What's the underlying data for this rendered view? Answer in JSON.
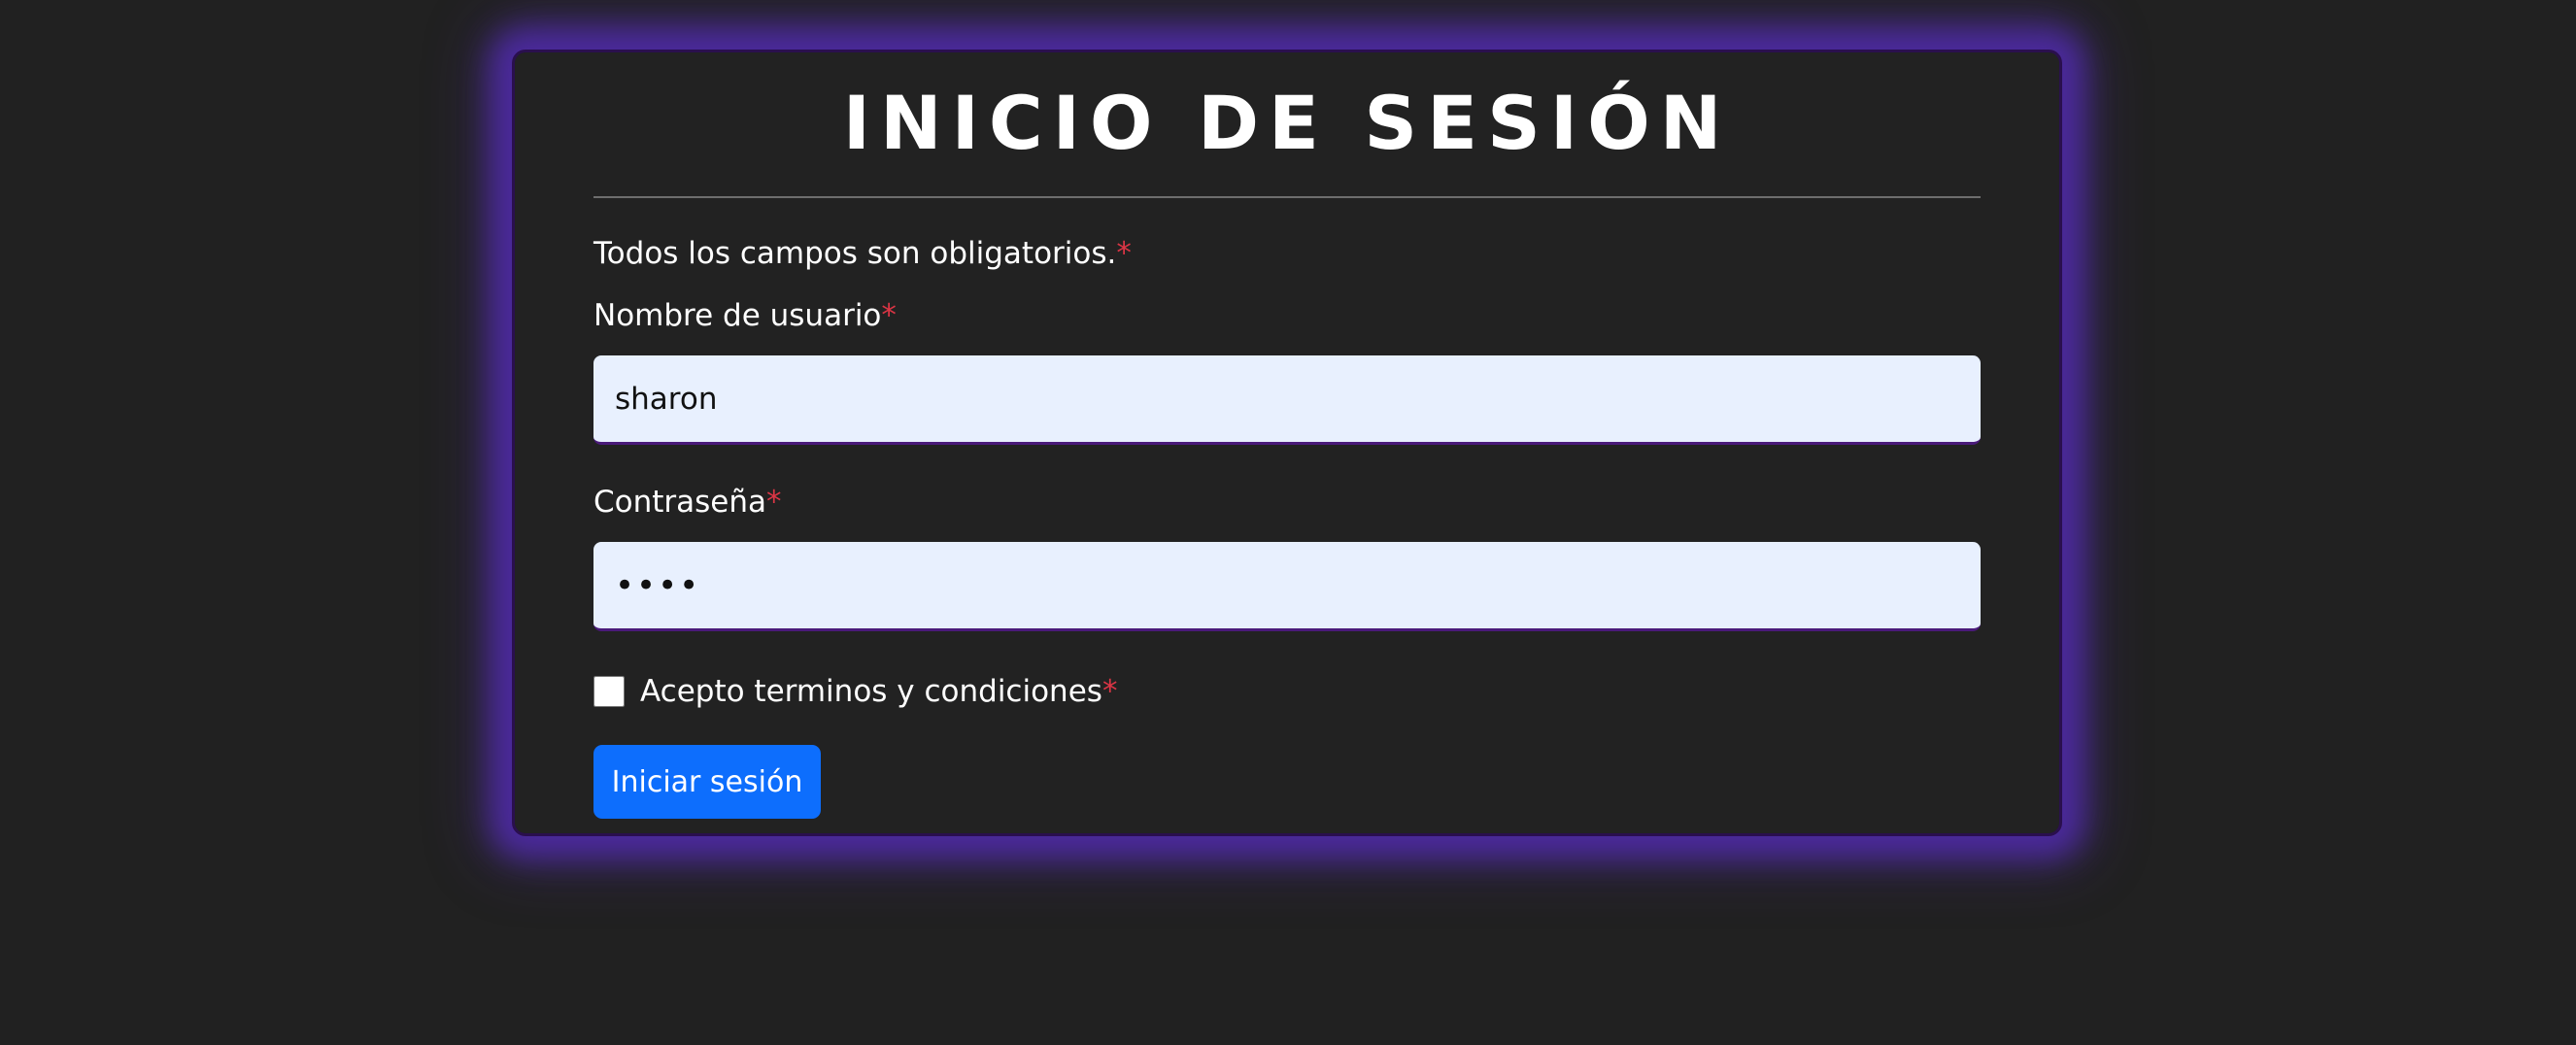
{
  "login": {
    "title": "INICIO DE SESIÓN",
    "required_note": "Todos los campos son obligatorios.",
    "required_marker": "*",
    "username": {
      "label": "Nombre de usuario",
      "value": "sharon"
    },
    "password": {
      "label": "Contraseña",
      "value": "••••"
    },
    "terms": {
      "label": "Acepto terminos y condiciones",
      "checked": false
    },
    "submit_label": "Iniciar sesión"
  },
  "colors": {
    "background": "#212121",
    "card": "#222222",
    "glow": "#4b2a9c",
    "input_bg": "#e8f0fe",
    "button": "#0d6efd",
    "required": "#dc3545"
  }
}
